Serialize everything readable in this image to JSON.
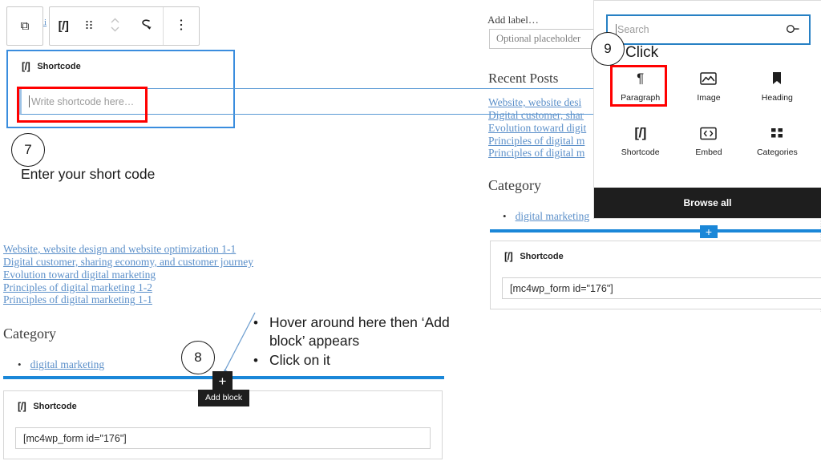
{
  "toolbar": {
    "buttons": [
      {
        "name": "copy-blocks",
        "icon": "copy-icon",
        "glyph": "⧉"
      },
      {
        "name": "block-type-shortcode",
        "icon": "shortcode-icon",
        "glyph": "[/]"
      },
      {
        "name": "drag-handle",
        "icon": "drag-handle-icon",
        "glyph": "⁙"
      },
      {
        "name": "move-up-down",
        "icon": "chevron-updown-icon",
        "glyph": "⌃⌄"
      },
      {
        "name": "transform-block",
        "icon": "arrow-curve-icon",
        "glyph": "↪"
      },
      {
        "name": "more-options",
        "icon": "vertical-dots-icon",
        "glyph": "⋮"
      }
    ],
    "stray_text": "li"
  },
  "selected_block": {
    "icon_glyph": "[/]",
    "label": "Shortcode",
    "input_placeholder": "Write shortcode here…"
  },
  "callouts": {
    "step7": {
      "number": "7",
      "text": "Enter your short code"
    },
    "step8": {
      "number": "8",
      "bullets": [
        "Hover around here then ‘Add block’ appears",
        "Click on it"
      ]
    },
    "step9": {
      "number": "9",
      "text": "Click"
    }
  },
  "left_preview": {
    "recent_posts_links": [
      "Website, website design and website optimization 1-1",
      "Digital customer, sharing economy, and customer journey",
      "Evolution toward digital marketing",
      "Principles of digital marketing 1-2",
      "Principles of digital marketing 1-1"
    ],
    "category_heading": "Category",
    "category_items": [
      "digital marketing"
    ],
    "bullet_glyph": "•"
  },
  "left_inserter": {
    "plus_glyph": "+",
    "tooltip": "Add block"
  },
  "left_bottom_block": {
    "icon_glyph": "[/]",
    "label": "Shortcode",
    "code_value": "[mc4wp_form id=\"176\"]"
  },
  "right_preview": {
    "add_label": "Add label…",
    "optional_placeholder": "Optional placeholder",
    "recent_posts_heading": "Recent Posts",
    "recent_posts_links": [
      "Website, website desi",
      "Digital customer, shar",
      "Evolution toward digit",
      "Principles of digital m",
      "Principles of digital m"
    ],
    "category_heading": "Category",
    "category_items": [
      "digital marketing"
    ],
    "bullet_glyph": "•"
  },
  "right_inserter": {
    "plus_glyph": "+"
  },
  "right_bottom_block": {
    "icon_glyph": "[/]",
    "label": "Shortcode",
    "code_value": "[mc4wp_form id=\"176\"]"
  },
  "block_inserter_popup": {
    "search_placeholder": "Search",
    "search_icon": "search-icon",
    "items": [
      {
        "label": "Paragraph",
        "icon": "paragraph-icon",
        "glyph": "¶"
      },
      {
        "label": "Image",
        "icon": "image-icon",
        "glyph": ""
      },
      {
        "label": "Heading",
        "icon": "heading-icon",
        "glyph": ""
      },
      {
        "label": "Shortcode",
        "icon": "shortcode-icon",
        "glyph": "[/]"
      },
      {
        "label": "Embed",
        "icon": "embed-code-icon",
        "glyph": ""
      },
      {
        "label": "Categories",
        "icon": "categories-icon",
        "glyph": ""
      }
    ],
    "browse_all_label": "Browse all"
  },
  "colors": {
    "selection_blue": "#3a8dde",
    "rail_blue": "#1a87d8",
    "highlight_red": "#ff0000",
    "link_blue": "#5b8fc9",
    "dark_ui": "#1e1e1e"
  }
}
